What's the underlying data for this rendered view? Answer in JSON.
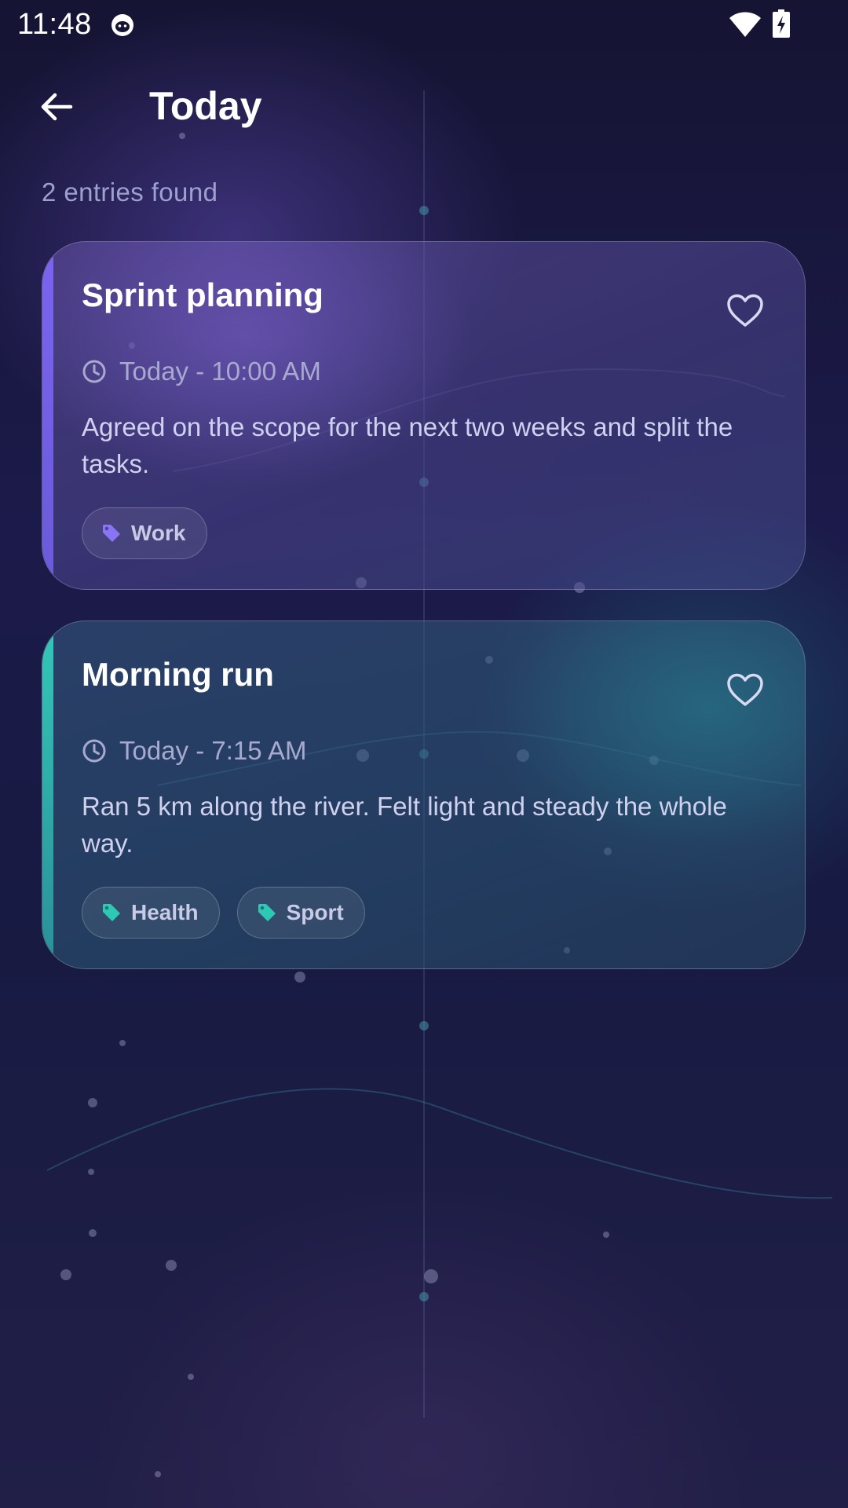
{
  "status_bar": {
    "time": "11:48",
    "icons": [
      "cat-app-icon",
      "wifi-icon",
      "battery-charging-icon"
    ]
  },
  "header": {
    "back_icon": "arrow-left-icon",
    "title": "Today"
  },
  "summary": {
    "entries_text": "2 entries found"
  },
  "entries": [
    {
      "title": "Sprint planning",
      "time": "Today - 10:00 AM",
      "body": "Agreed on the scope for the next two weeks and split the tasks.",
      "accent_color": "#7b64f0",
      "favorite": false,
      "tags": [
        {
          "label": "Work",
          "color": "#8a73f5"
        }
      ]
    },
    {
      "title": "Morning run",
      "time": "Today - 7:15 AM",
      "body": "Ran 5 km along the river. Felt light and steady the whole way.",
      "accent_color": "#34c7b8",
      "favorite": false,
      "tags": [
        {
          "label": "Health",
          "color": "#2ec9b5"
        },
        {
          "label": "Sport",
          "color": "#2ec9b5"
        }
      ]
    }
  ],
  "colors": {
    "background_top": "#151433",
    "background_bottom": "#211f48",
    "muted_text": "#9da1cf"
  }
}
